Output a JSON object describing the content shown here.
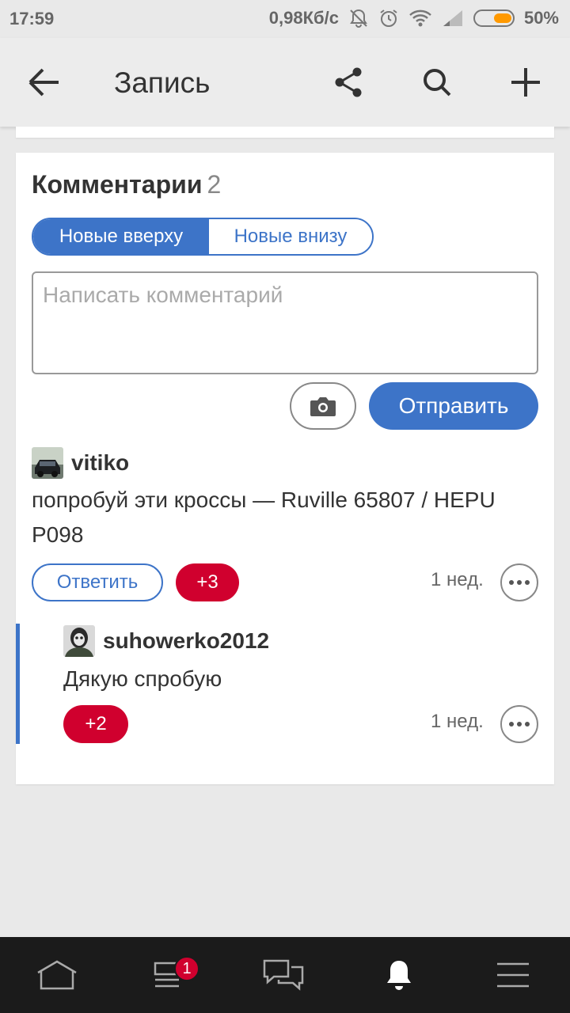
{
  "status_bar": {
    "time": "17:59",
    "speed": "0,98Кб/с",
    "battery": "50%",
    "icons": [
      "notifications-off-icon",
      "alarm-icon",
      "wifi-icon",
      "signal-icon",
      "battery-icon"
    ]
  },
  "app_bar": {
    "title": "Запись",
    "icons": [
      "back-arrow-icon",
      "share-icon",
      "search-icon",
      "plus-icon"
    ]
  },
  "comments": {
    "title": "Комментарии",
    "count": "2",
    "sort": {
      "options": [
        "Новые вверху",
        "Новые внизу"
      ],
      "selected": "Новые вверху"
    },
    "input_placeholder": "Написать комментарий",
    "send_label": "Отправить",
    "items": [
      {
        "author": "vitiko",
        "text": "попробуй эти кроссы — Ruville 65807 / HEPU P098",
        "reply_label": "Ответить",
        "score": "+3",
        "time": "1 нед."
      },
      {
        "author": "suhowerko2012",
        "text": "Дякую спробую",
        "score": "+2",
        "time": "1 нед."
      }
    ]
  },
  "bottom_nav": {
    "items": [
      "home-icon",
      "feed-icon",
      "messages-icon",
      "notifications-icon",
      "menu-icon"
    ],
    "feed_badge": "1",
    "active": "notifications-icon"
  },
  "colors": {
    "accent": "#3d74c8",
    "score": "#d0002e",
    "nav_bg": "#1b1b1b",
    "page_bg": "#e9e9e9"
  }
}
